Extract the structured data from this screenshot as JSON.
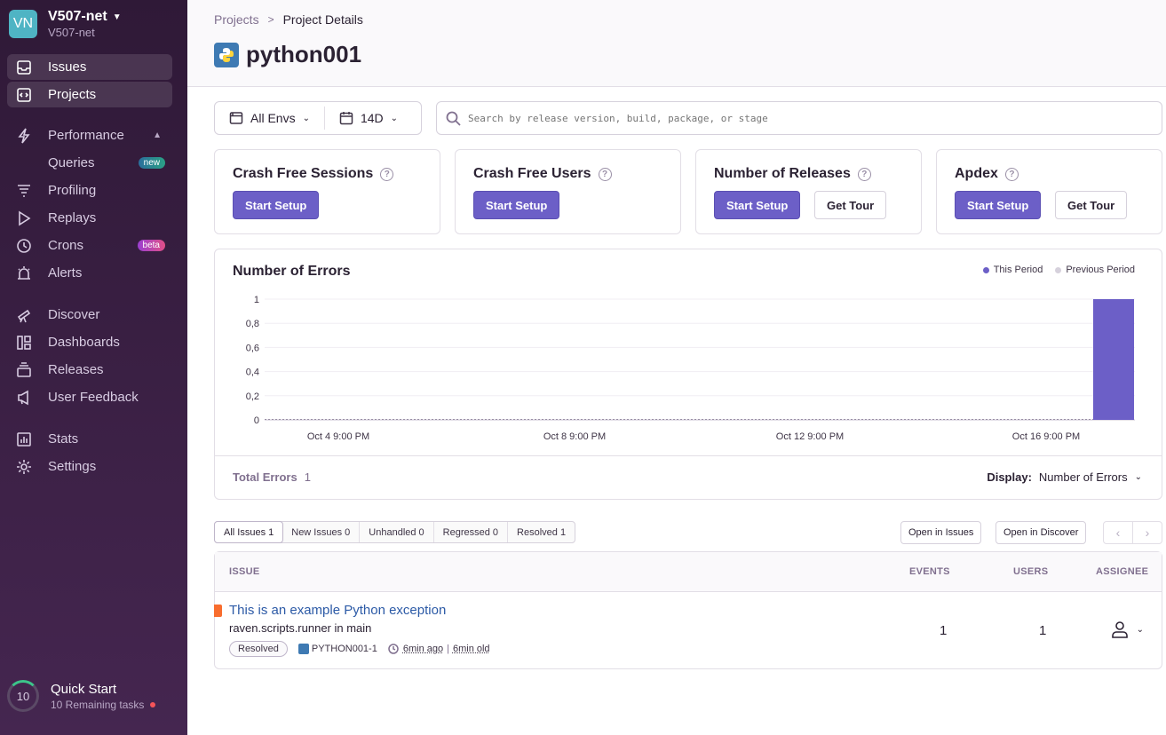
{
  "org": {
    "initials": "VN",
    "name": "V507-net",
    "slug": "V507-net"
  },
  "sidebar": {
    "items": [
      {
        "label": "Issues"
      },
      {
        "label": "Projects"
      },
      {
        "label": "Performance"
      },
      {
        "label": "Queries",
        "badge": "new"
      },
      {
        "label": "Profiling"
      },
      {
        "label": "Replays"
      },
      {
        "label": "Crons",
        "badge": "beta"
      },
      {
        "label": "Alerts"
      },
      {
        "label": "Discover"
      },
      {
        "label": "Dashboards"
      },
      {
        "label": "Releases"
      },
      {
        "label": "User Feedback"
      },
      {
        "label": "Stats"
      },
      {
        "label": "Settings"
      }
    ],
    "quick_start": {
      "count": "10",
      "title": "Quick Start",
      "subtitle": "10 Remaining tasks"
    }
  },
  "breadcrumb": {
    "parent": "Projects",
    "current": "Project Details"
  },
  "project": {
    "name": "python001"
  },
  "filters": {
    "env": "All Envs",
    "period": "14D",
    "search_placeholder": "Search by release version, build, package, or stage"
  },
  "cards": [
    {
      "title": "Crash Free Sessions",
      "primary": "Start Setup"
    },
    {
      "title": "Crash Free Users",
      "primary": "Start Setup"
    },
    {
      "title": "Number of Releases",
      "primary": "Start Setup",
      "secondary": "Get Tour"
    },
    {
      "title": "Apdex",
      "primary": "Start Setup",
      "secondary": "Get Tour"
    }
  ],
  "errors_chart": {
    "title": "Number of Errors",
    "legend": {
      "this_period": "This Period",
      "previous_period": "Previous Period"
    },
    "total_label": "Total Errors",
    "total_value": "1",
    "display_label": "Display:",
    "display_value": "Number of Errors"
  },
  "chart_data": {
    "type": "bar",
    "y_ticks": [
      "0",
      "0,2",
      "0,4",
      "0,6",
      "0,8",
      "1"
    ],
    "x_ticks": [
      "Oct 4 9:00 PM",
      "Oct 8 9:00 PM",
      "Oct 12 9:00 PM",
      "Oct 16 9:00 PM"
    ],
    "ylim": [
      0,
      1
    ],
    "series": [
      {
        "name": "This Period",
        "color": "#6c5fc7",
        "x": [
          "Oct 18"
        ],
        "values": [
          1
        ]
      },
      {
        "name": "Previous Period",
        "color": "#d6d1dc",
        "values": [
          0
        ]
      }
    ]
  },
  "issue_tabs": [
    {
      "label": "All Issues 1"
    },
    {
      "label": "New Issues 0"
    },
    {
      "label": "Unhandled 0"
    },
    {
      "label": "Regressed 0"
    },
    {
      "label": "Resolved 1"
    }
  ],
  "actions": {
    "open_issues": "Open in Issues",
    "open_discover": "Open in Discover",
    "prev": "‹",
    "next": "›"
  },
  "table": {
    "headers": {
      "issue": "ISSUE",
      "events": "EVENTS",
      "users": "USERS",
      "assignee": "ASSIGNEE"
    },
    "rows": [
      {
        "title": "This is an example Python exception",
        "culprit": "raven.scripts.runner in main",
        "status": "Resolved",
        "short_id": "PYTHON001-1",
        "last_seen": "6min ago",
        "first_seen": "6min old",
        "events": "1",
        "users": "1"
      }
    ]
  }
}
